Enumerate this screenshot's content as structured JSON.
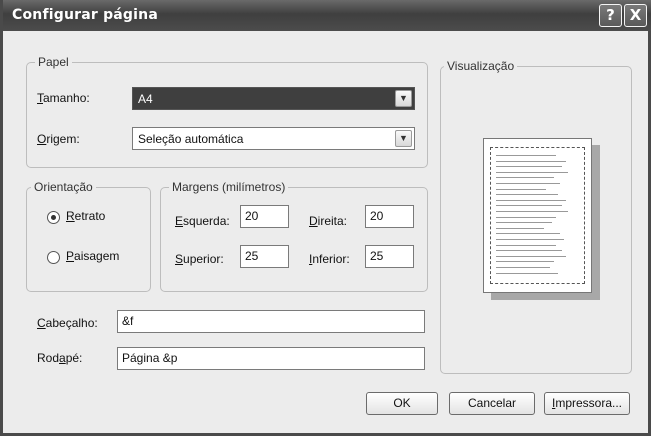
{
  "window": {
    "title": "Configurar página",
    "help_button": "?",
    "close_button": "X"
  },
  "paper": {
    "group_label": "Papel",
    "size_label": "Tamanho:",
    "size_value": "A4",
    "source_label": "Origem:",
    "source_value": "Seleção automática"
  },
  "orientation": {
    "group_label": "Orientação",
    "portrait_label": "Retrato",
    "landscape_label": "Paisagem",
    "selected": "portrait"
  },
  "margins": {
    "group_label": "Margens (milímetros)",
    "left_label": "Esquerda:",
    "left_value": "20",
    "right_label": "Direita:",
    "right_value": "20",
    "top_label": "Superior:",
    "top_value": "25",
    "bottom_label": "Inferior:",
    "bottom_value": "25"
  },
  "header": {
    "label": "Cabeçalho:",
    "value": "&f"
  },
  "footer": {
    "label": "Rodapé:",
    "value": "Página &p"
  },
  "preview": {
    "group_label": "Visualização"
  },
  "buttons": {
    "ok": "OK",
    "cancel": "Cancelar",
    "printer": "Impressora..."
  }
}
